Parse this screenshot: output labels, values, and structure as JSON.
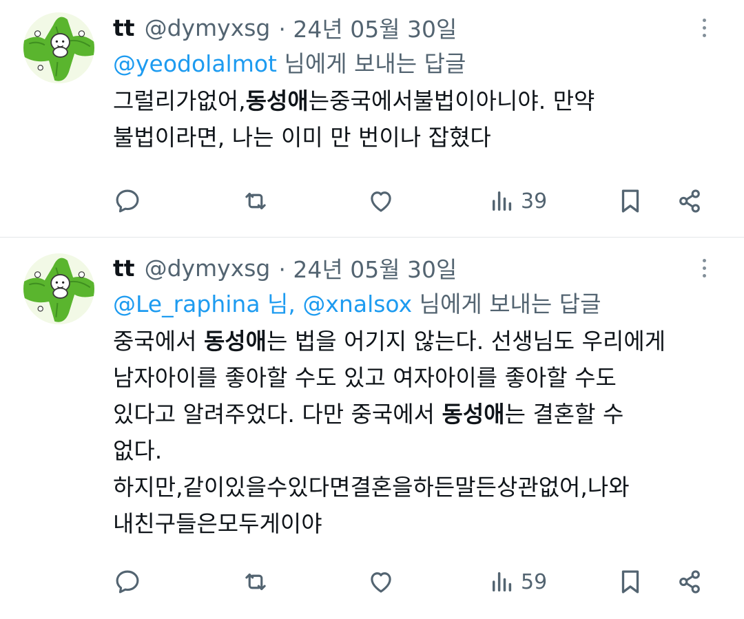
{
  "tweets": [
    {
      "user": {
        "name": "tt",
        "handle": "@dymyxsg",
        "date": "· 24년 05월 30일"
      },
      "replying": {
        "mentions": "@yeodolalmot",
        "suffix": " 님에게 보내는 답글"
      },
      "body": {
        "l1a": "그럴리가없어,",
        "l1b": "동성애",
        "l1c": "는중국에서불법이아니야. 만약",
        "l2": "불법이라면, 나는 이미 만 번이나 잡혔다"
      },
      "views": "39"
    },
    {
      "user": {
        "name": "tt",
        "handle": "@dymyxsg",
        "date": "· 24년 05월 30일"
      },
      "replying": {
        "mention1": "@Le_raphina 님,",
        "mention2": "@xnalsox",
        "suffix": " 님에게 보내는 답글"
      },
      "body": {
        "l1a": "중국에서 ",
        "l1b": "동성애",
        "l1c": "는 법을 어기지 않는다. 선생님도 우리에게",
        "l2": "남자아이를 좋아할 수도 있고 여자아이를 좋아할 수도",
        "l3a": "있다고 알려주었다. 다만 중국에서 ",
        "l3b": "동성애",
        "l3c": "는 결혼할 수",
        "l4": "없다.",
        "l5": "하지만,같이있을수있다면결혼을하든말든상관없어,나와",
        "l6": "내친구들은모두게이야"
      },
      "views": "59"
    }
  ],
  "icons": {
    "reply": "reply-icon",
    "retweet": "retweet-icon",
    "like": "heart-icon",
    "views": "bar-chart-icon",
    "bookmark": "bookmark-icon",
    "share": "share-icon",
    "more": "more-icon"
  },
  "colors": {
    "link": "#1d9bf0",
    "muted": "#536471",
    "text": "#0f1419",
    "avatar_green": "#5ab52e"
  }
}
